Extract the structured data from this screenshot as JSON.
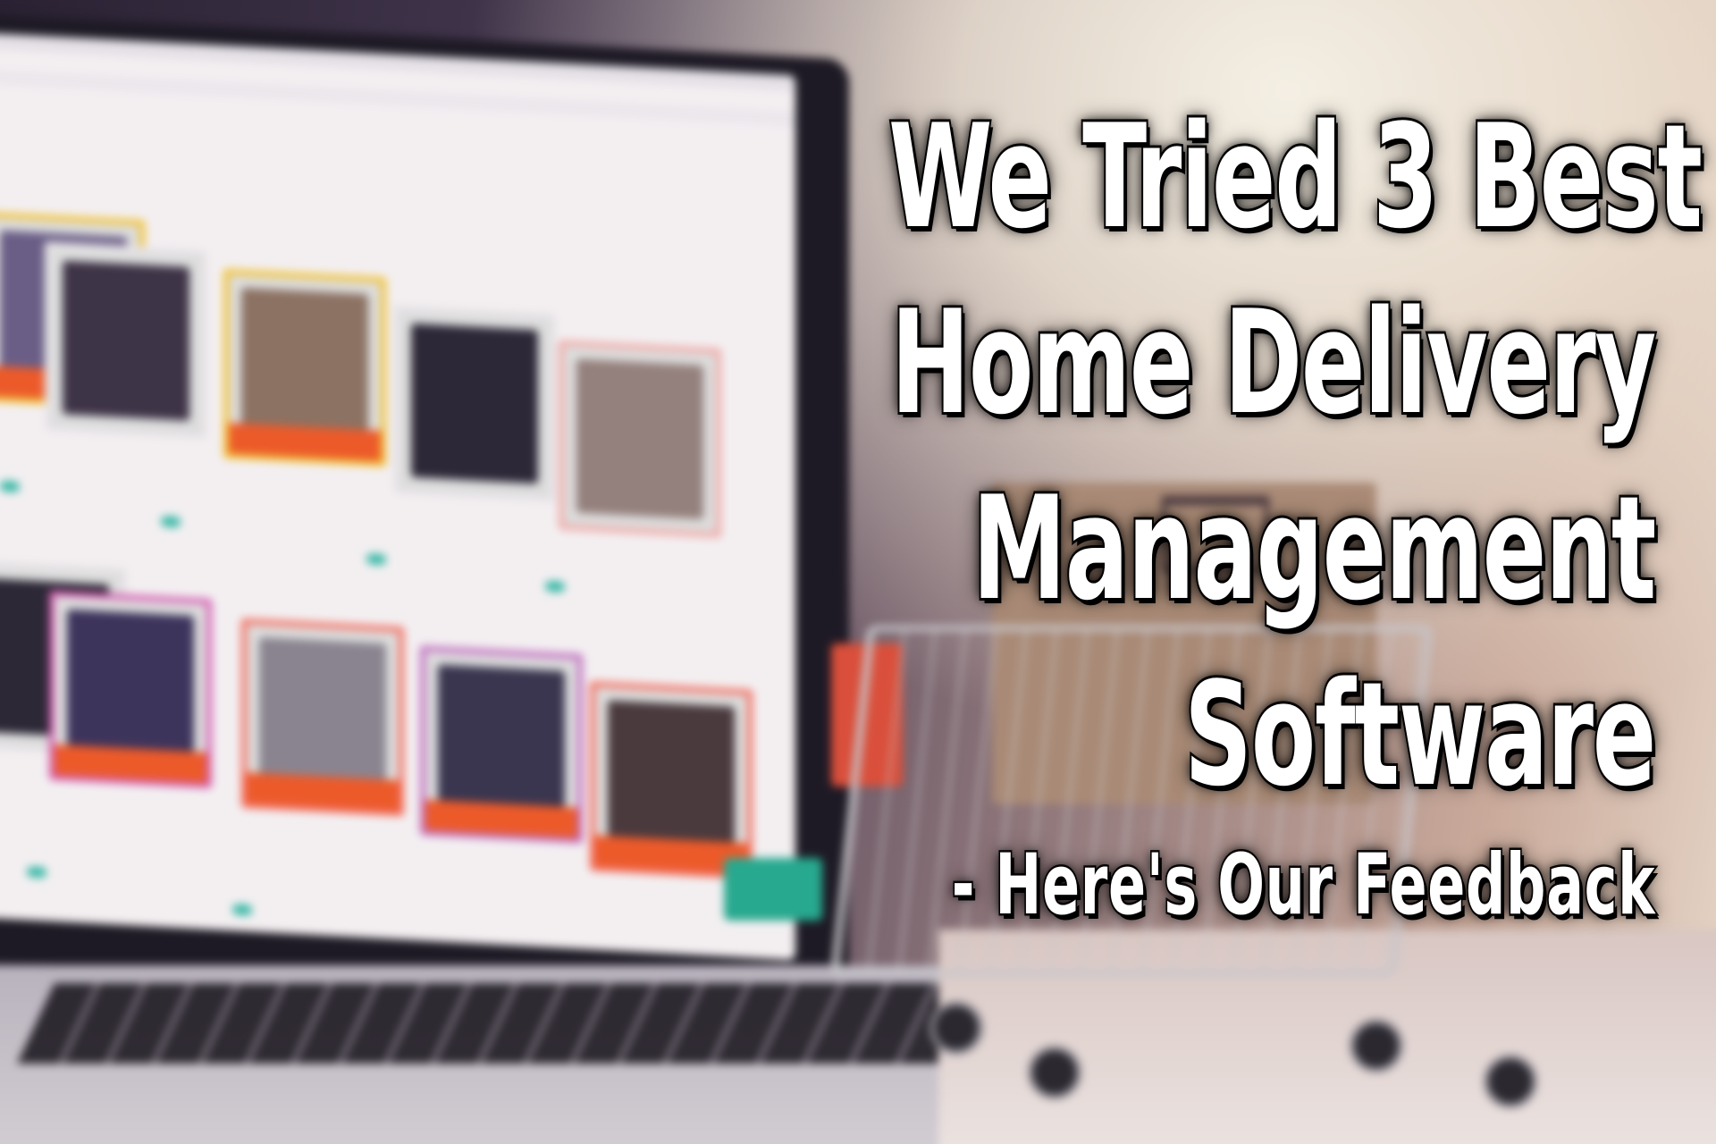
{
  "headline": {
    "line1": "We Tried 3 Best",
    "line2": "Home Delivery",
    "line3": "Management",
    "line4": "Software",
    "line5": "- Here's Our Feedback"
  },
  "colors": {
    "text": "#ffffff",
    "text_outline": "#000000",
    "card_border": "#f2c12e",
    "price_tag": "#ec5a2a",
    "accent_green": "#27a98f",
    "cart_handle": "#d94f3b"
  }
}
